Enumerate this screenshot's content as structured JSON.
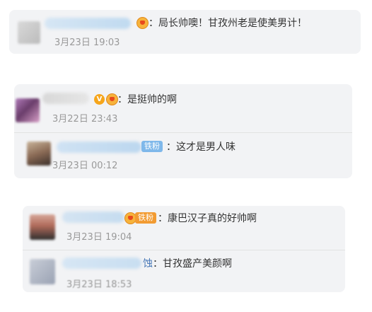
{
  "cards": [
    {
      "comments": [
        {
          "text": "：局长帅噢！甘孜州老是使美男计！",
          "time": "3月23日 19:03",
          "badge": "fan"
        }
      ]
    },
    {
      "comments": [
        {
          "text": "：是挺帅的啊",
          "time": "3月22日 23:43",
          "badge": "verified-fan"
        },
        {
          "text": "：这才是男人味",
          "time": "3月23日 00:12",
          "badge": "铁粉"
        }
      ]
    },
    {
      "comments": [
        {
          "text": "：康巴汉子真的好帅啊",
          "time": "3月23日 19:04",
          "badge": "铁粉"
        },
        {
          "text": "：甘孜盛产美颜啊",
          "time": "3月23日 18:53",
          "badge": "none",
          "name_tail": "蚀"
        }
      ]
    }
  ],
  "badges": {
    "verified_letter": "V",
    "iron_fan_label": "铁粉"
  },
  "colors": {
    "card_bg": "#f2f3f5",
    "text": "#333333",
    "time": "#999999",
    "iron_fan": "#7fb8ea",
    "verified": "#f6a61c"
  }
}
